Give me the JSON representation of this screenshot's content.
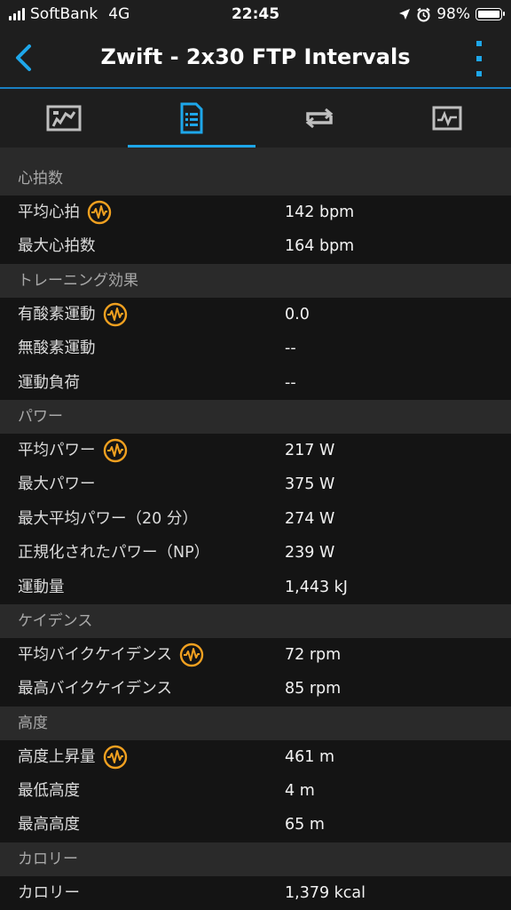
{
  "status_bar": {
    "carrier": "SoftBank",
    "network": "4G",
    "time": "22:45",
    "battery": "98%"
  },
  "nav": {
    "title": "Zwift - 2x30 FTP Intervals"
  },
  "tabs": [
    {
      "icon": "chart-image-icon",
      "active": false
    },
    {
      "icon": "details-list-icon",
      "active": true
    },
    {
      "icon": "repeat-laps-icon",
      "active": false
    },
    {
      "icon": "graph-icon",
      "active": false
    }
  ],
  "colors": {
    "accent": "#1ea7ea",
    "badge": "#f0a020",
    "header_bg": "#2a2a2a",
    "row_bg": "#141414"
  },
  "sections": [
    {
      "title": "心拍数",
      "rows": [
        {
          "label": "平均心拍",
          "value": "142 bpm",
          "badge": true
        },
        {
          "label": "最大心拍数",
          "value": "164 bpm",
          "badge": false
        }
      ]
    },
    {
      "title": "トレーニング効果",
      "rows": [
        {
          "label": "有酸素運動",
          "value": "0.0",
          "badge": true
        },
        {
          "label": "無酸素運動",
          "value": "--",
          "badge": false
        },
        {
          "label": "運動負荷",
          "value": "--",
          "badge": false
        }
      ]
    },
    {
      "title": "パワー",
      "rows": [
        {
          "label": "平均パワー",
          "value": "217 W",
          "badge": true
        },
        {
          "label": "最大パワー",
          "value": "375 W",
          "badge": false
        },
        {
          "label": "最大平均パワー（20 分）",
          "value": "274 W",
          "badge": false
        },
        {
          "label": "正規化されたパワー（NP）",
          "value": "239 W",
          "badge": false
        },
        {
          "label": "運動量",
          "value": "1,443 kJ",
          "badge": false
        }
      ]
    },
    {
      "title": "ケイデンス",
      "rows": [
        {
          "label": "平均バイクケイデンス",
          "value": "72 rpm",
          "badge": true
        },
        {
          "label": "最高バイクケイデンス",
          "value": "85 rpm",
          "badge": false
        }
      ]
    },
    {
      "title": "高度",
      "rows": [
        {
          "label": "高度上昇量",
          "value": "461 m",
          "badge": true
        },
        {
          "label": "最低高度",
          "value": "4 m",
          "badge": false
        },
        {
          "label": "最高高度",
          "value": "65 m",
          "badge": false
        }
      ]
    },
    {
      "title": "カロリー",
      "rows": [
        {
          "label": "カロリー",
          "value": "1,379 kcal",
          "badge": false
        }
      ]
    }
  ]
}
